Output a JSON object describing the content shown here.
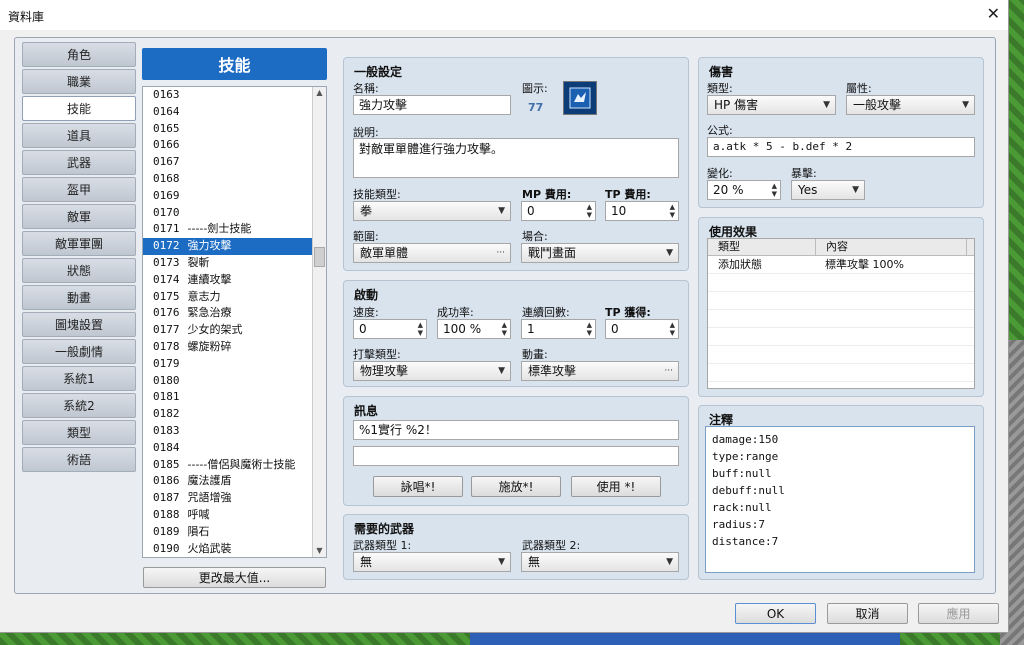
{
  "window": {
    "title": "資料庫",
    "close_glyph": "✕"
  },
  "nav": {
    "items": [
      "角色",
      "職業",
      "技能",
      "道具",
      "武器",
      "盔甲",
      "敵軍",
      "敵軍軍團",
      "狀態",
      "動畫",
      "圖塊設置",
      "一般劇情",
      "系統1",
      "系統2",
      "類型",
      "術語"
    ],
    "active": "技能"
  },
  "list": {
    "header": "技能",
    "rows": [
      {
        "id": "0163",
        "name": ""
      },
      {
        "id": "0164",
        "name": ""
      },
      {
        "id": "0165",
        "name": ""
      },
      {
        "id": "0166",
        "name": ""
      },
      {
        "id": "0167",
        "name": ""
      },
      {
        "id": "0168",
        "name": ""
      },
      {
        "id": "0169",
        "name": ""
      },
      {
        "id": "0170",
        "name": ""
      },
      {
        "id": "0171",
        "name": "-----劍士技能"
      },
      {
        "id": "0172",
        "name": "強力攻擊"
      },
      {
        "id": "0173",
        "name": "裂斬"
      },
      {
        "id": "0174",
        "name": "連續攻擊"
      },
      {
        "id": "0175",
        "name": "意志力"
      },
      {
        "id": "0176",
        "name": "緊急治療"
      },
      {
        "id": "0177",
        "name": "少女的架式"
      },
      {
        "id": "0178",
        "name": "螺旋粉碎"
      },
      {
        "id": "0179",
        "name": ""
      },
      {
        "id": "0180",
        "name": ""
      },
      {
        "id": "0181",
        "name": ""
      },
      {
        "id": "0182",
        "name": ""
      },
      {
        "id": "0183",
        "name": ""
      },
      {
        "id": "0184",
        "name": ""
      },
      {
        "id": "0185",
        "name": "-----僧侶與魔術士技能"
      },
      {
        "id": "0186",
        "name": "魔法護盾"
      },
      {
        "id": "0187",
        "name": "咒語增強"
      },
      {
        "id": "0188",
        "name": "呼喊"
      },
      {
        "id": "0189",
        "name": "隕石"
      },
      {
        "id": "0190",
        "name": "火焰武裝"
      }
    ],
    "selected_id": "0172",
    "max_button": "更改最大值..."
  },
  "general": {
    "header": "一般設定",
    "name_label": "名稱:",
    "name_value": "強力攻擊",
    "icon_label": "圖示:",
    "icon_index": "77",
    "desc_label": "說明:",
    "desc_value": "對敵軍單體進行強力攻擊。",
    "skill_type_label": "技能類型:",
    "skill_type_value": "拳",
    "mp_label": "MP 費用:",
    "mp_value": "0",
    "tp_label": "TP 費用:",
    "tp_value": "10",
    "scope_label": "範圍:",
    "scope_value": "敵軍單體",
    "occasion_label": "場合:",
    "occasion_value": "戰鬥畫面"
  },
  "invocation": {
    "header": "啟動",
    "speed_label": "速度:",
    "speed_value": "0",
    "success_label": "成功率:",
    "success_value": "100 %",
    "repeat_label": "連續回數:",
    "repeat_value": "1",
    "tpgain_label": "TP 獲得:",
    "tpgain_value": "0",
    "hit_label": "打擊類型:",
    "hit_value": "物理攻擊",
    "anim_label": "動畫:",
    "anim_value": "標準攻擊"
  },
  "message": {
    "header": "訊息",
    "line1": "%1實行 %2！",
    "line2": "",
    "btn_chant": "詠唱*!",
    "btn_cast": "施放*!",
    "btn_use": "使用 *!"
  },
  "weapons": {
    "header": "需要的武器",
    "w1_label": "武器類型 1:",
    "w1_value": "無",
    "w2_label": "武器類型 2:",
    "w2_value": "無"
  },
  "damage": {
    "header": "傷害",
    "type_label": "類型:",
    "type_value": "HP 傷害",
    "element_label": "屬性:",
    "element_value": "一般攻擊",
    "formula_label": "公式:",
    "formula_value": "a.atk * 5 - b.def * 2",
    "variance_label": "變化:",
    "variance_value": "20 %",
    "critical_label": "暴擊:",
    "critical_value": "Yes"
  },
  "effects": {
    "header": "使用效果",
    "col_type": "類型",
    "col_content": "內容",
    "rows": [
      {
        "type": "添加狀態",
        "content": "標準攻擊 100%"
      }
    ]
  },
  "note": {
    "header": "注釋",
    "lines": [
      "damage:150",
      "type:range",
      "buff:null",
      "debuff:null",
      "rack:null",
      "radius:7",
      "distance:7"
    ]
  },
  "footer": {
    "ok": "OK",
    "cancel": "取消",
    "apply": "應用"
  }
}
